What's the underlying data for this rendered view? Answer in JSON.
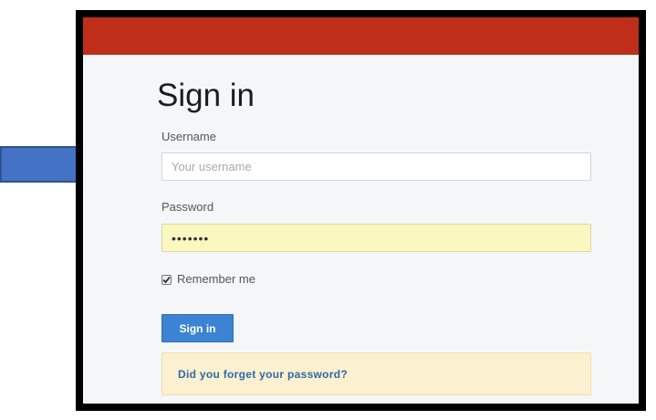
{
  "login_form": {
    "title": "Sign in",
    "username": {
      "label": "Username",
      "value": "",
      "placeholder": "Your username"
    },
    "password": {
      "label": "Password",
      "masked_value": "•••••••"
    },
    "remember_me": {
      "label": "Remember me",
      "checked": true
    },
    "submit_label": "Sign in",
    "forgot_password_link": "Did you forget your password?"
  },
  "colors": {
    "header_bar": "#be2e19",
    "primary_button": "#3d83d3",
    "annotation_arrow": "#4472c4",
    "autofill_background": "#fbf8bf",
    "notice_background": "#fbf0cf"
  },
  "icons": {
    "annotation": "right-arrow-icon",
    "checkbox": "checkmark-icon"
  }
}
